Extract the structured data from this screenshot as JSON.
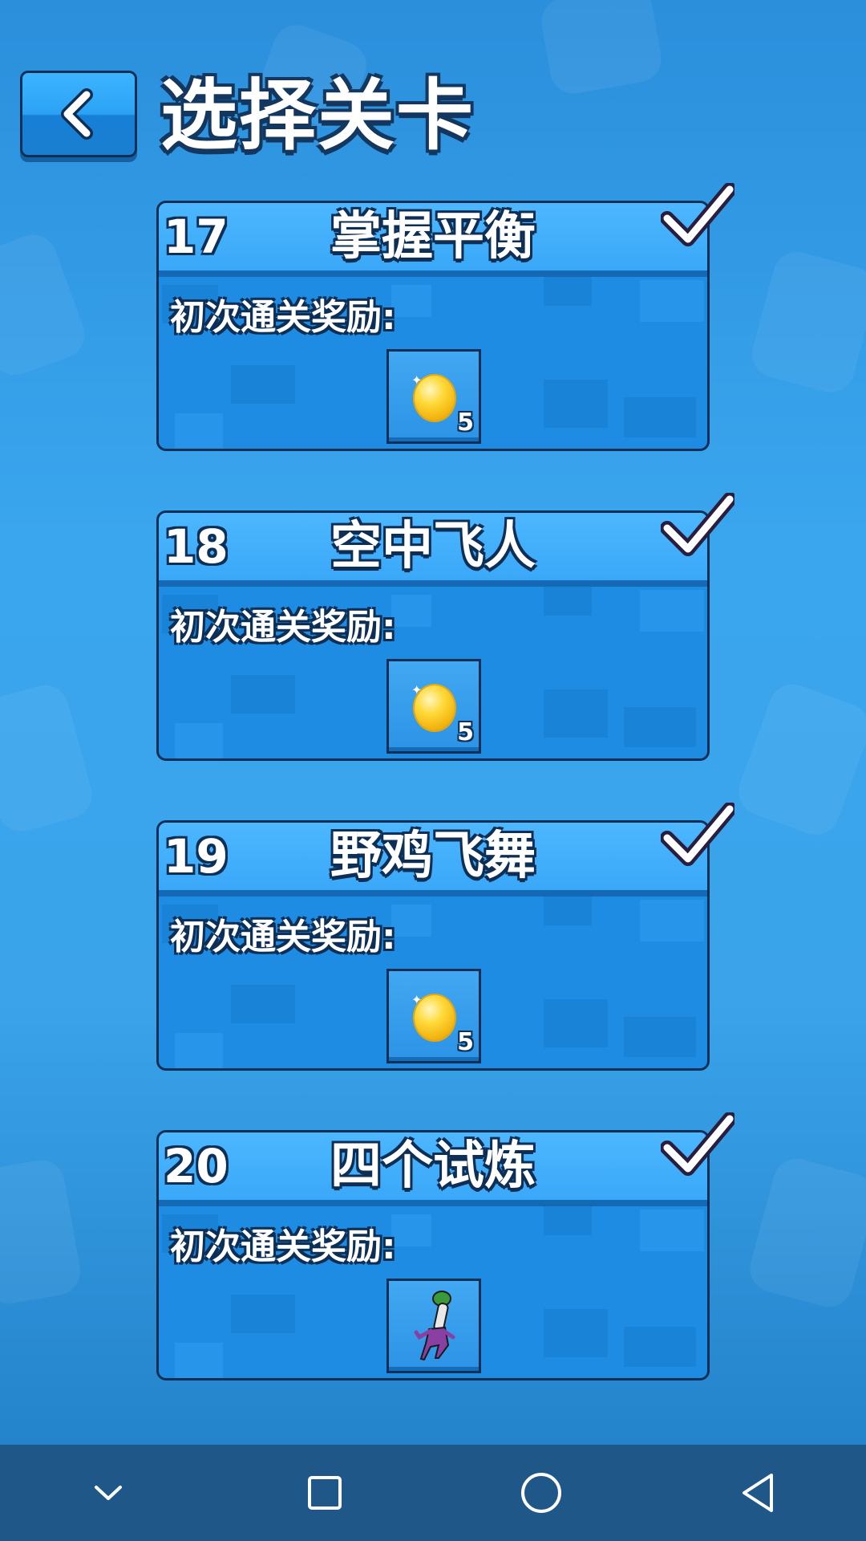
{
  "header": {
    "title": "选择关卡"
  },
  "reward_label": "初次通关奖励:",
  "levels": [
    {
      "number": "17",
      "name": "掌握平衡",
      "reward": {
        "type": "coin",
        "count": "5"
      },
      "completed": true
    },
    {
      "number": "18",
      "name": "空中飞人",
      "reward": {
        "type": "coin",
        "count": "5"
      },
      "completed": true
    },
    {
      "number": "19",
      "name": "野鸡飞舞",
      "reward": {
        "type": "coin",
        "count": "5"
      },
      "completed": true
    },
    {
      "number": "20",
      "name": "四个试炼",
      "reward": {
        "type": "character-skin"
      },
      "completed": true
    }
  ],
  "navbar": {
    "buttons": [
      "chevron-down-icon",
      "square-icon",
      "circle-icon",
      "triangle-back-icon"
    ]
  },
  "colors": {
    "background": "#3aa6ee",
    "card": "#1d8ce2",
    "outline": "#0e2f55",
    "coin": "#ffd93a",
    "navbar": "#1f5888"
  }
}
